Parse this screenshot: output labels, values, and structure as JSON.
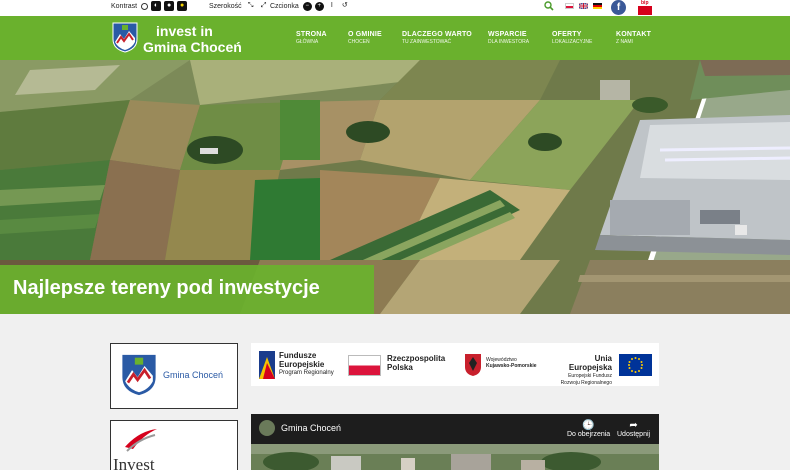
{
  "a11y": {
    "contrast_label": "Kontrast",
    "width_label": "Szerokość",
    "font_label": "Czcionka"
  },
  "bip_label": "bip",
  "logo": {
    "line1": "invest in",
    "line2": "Gmina Choceń"
  },
  "nav": [
    {
      "title": "STRONA",
      "sub": "GŁÓWNA"
    },
    {
      "title": "O GMINIE",
      "sub": "CHOCEŃ"
    },
    {
      "title": "DLACZEGO WARTO",
      "sub": "TU ZAINWESTOWAĆ"
    },
    {
      "title": "WSPARCIE",
      "sub": "DLA INWESTORA"
    },
    {
      "title": "OFERTY",
      "sub": "LOKALIZACYJNE"
    },
    {
      "title": "KONTAKT",
      "sub": "Z NAMI"
    }
  ],
  "hero": {
    "caption": "Najlepsze tereny pod inwestycje"
  },
  "partner_card": {
    "name": "Gmina Choceń"
  },
  "invest_card": {
    "word": "Invest"
  },
  "eu_banner": {
    "fe_line1": "Fundusze",
    "fe_line2": "Europejskie",
    "fe_line3": "Program Regionalny",
    "rp_line1": "Rzeczpospolita",
    "rp_line2": "Polska",
    "woj_line1": "Województwo",
    "woj_line2": "Kujawsko-Pomorskie",
    "ue_line1": "Unia Europejska",
    "ue_line2": "Europejski Fundusz",
    "ue_line3": "Rozwoju Regionalnego"
  },
  "video": {
    "title": "Gmina Choceń",
    "watch_later": "Do obejrzenia",
    "share": "Udostępnij"
  },
  "colors": {
    "brand_green": "#6ab12d",
    "dark": "#1d1d1d",
    "crest_blue": "#2a5aa5",
    "crest_red": "#c8202c"
  }
}
